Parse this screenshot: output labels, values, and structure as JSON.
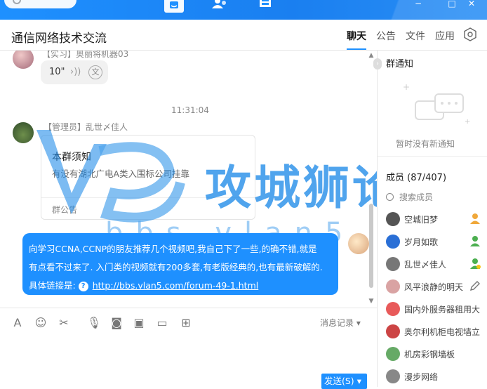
{
  "window": {
    "tab_icons": [
      "chat-bubble-icon",
      "contacts-icon",
      "files-icon"
    ],
    "controls": [
      "−",
      "□",
      "✕"
    ]
  },
  "header": {
    "title": "通信网络技术交流",
    "tabs": [
      "聊天",
      "公告",
      "文件",
      "应用"
    ],
    "active_tab": "聊天"
  },
  "chat": {
    "messages": [
      {
        "type": "voice",
        "sender": "【实习】奥丽将机器03",
        "duration": "10\"",
        "translate_icon": "文"
      },
      {
        "type": "time",
        "text": "11:31:04"
      },
      {
        "type": "notice",
        "sender": "【管理员】乱世〆佳人",
        "card_title": "本群须知",
        "card_body": "有没有湖北广电A类入围标公司挂靠",
        "card_footer": "群公告"
      },
      {
        "type": "text",
        "line1": "向学习CCNA,CCNP的朋友推荐几个视频吧,我自己下了一些,的确不错,就是",
        "line2": "有点看不过来了. 入门类的视频就有200多套,有老版经典的,也有最新破解的.",
        "line3_prefix": "具体链接是:",
        "link": "http://bbs.vlan5.com/forum-49-1.html"
      }
    ]
  },
  "toolbar": {
    "icons": [
      "font-icon",
      "emoji-icon",
      "scissors-icon",
      "mic-icon",
      "sticker-icon",
      "image-icon",
      "folder-icon",
      "apps-icon"
    ],
    "history_label": "消息记录"
  },
  "send": {
    "label": "发送(S)"
  },
  "sidebar": {
    "notice_title": "群通知",
    "notice_empty": "暂时没有新通知",
    "members_title": "成员 (87/407)",
    "search_label": "搜索成员",
    "members": [
      {
        "name": "空城旧梦",
        "badge": "owner",
        "color": "#555"
      },
      {
        "name": "岁月如歌",
        "badge": "admin",
        "color": "#2a6fd6"
      },
      {
        "name": "乱世〆佳人",
        "badge": "admin-star",
        "color": "#777"
      },
      {
        "name": "风平浪静的明天",
        "badge": "edit",
        "color": "#d9a3a3"
      },
      {
        "name": "国内外服务器租用大",
        "badge": "",
        "color": "#e85a5a"
      },
      {
        "name": "奥尔利机柜电视墙立",
        "badge": "",
        "color": "#c44"
      },
      {
        "name": "机房彩钢墙板",
        "badge": "",
        "color": "#6a6"
      },
      {
        "name": "漫步网络",
        "badge": "",
        "color": "#888"
      }
    ]
  },
  "watermark": {
    "brand": "攻城狮论坛",
    "domain": "bbs.vlan5.com"
  },
  "colors": {
    "accent": "#1e90ff",
    "watermark_blue": "#1f8be8"
  }
}
